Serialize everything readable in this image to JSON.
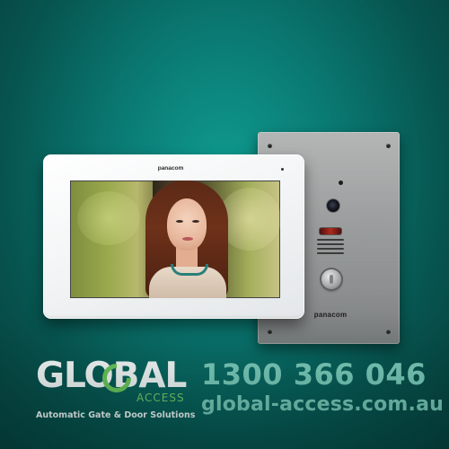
{
  "monitor": {
    "brand": "panacom"
  },
  "door_station": {
    "brand": "panacom"
  },
  "brand": {
    "name": "GLOBAL",
    "subname": "ACCESS",
    "tagline": "Automatic Gate & Door Solutions"
  },
  "contact": {
    "phone": "1300 366 046",
    "website": "global-access.com.au"
  },
  "colors": {
    "background": "#0a7a73",
    "accent_green": "#6fcb5a",
    "contact_text": "#7fd0bf"
  }
}
